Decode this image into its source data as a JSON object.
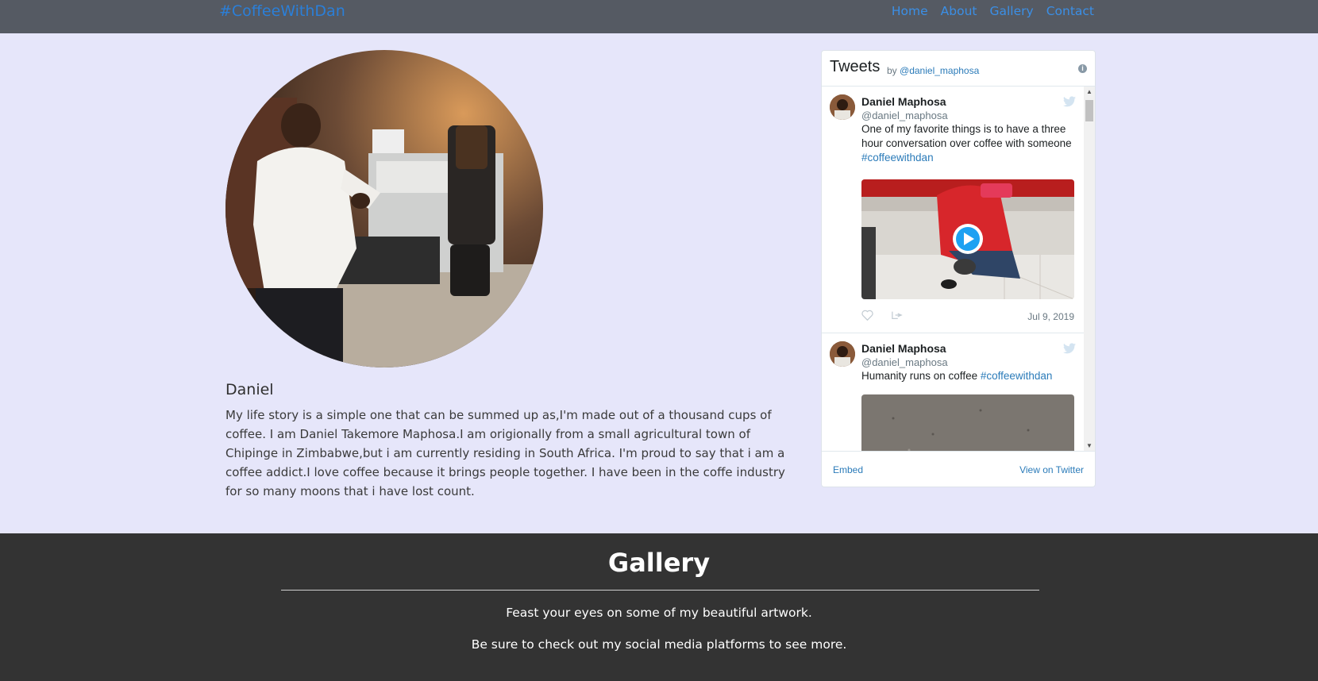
{
  "nav": {
    "brand": "#CoffeeWithDan",
    "links": [
      "Home",
      "About",
      "Gallery",
      "Contact"
    ]
  },
  "profile": {
    "name": "Daniel",
    "bio": "My life story is a simple one that can be summed up as,I'm made out of a thousand cups of coffee. I am Daniel Takemore Maphosa.I am origionally from a small agricultural town of Chipinge in Zimbabwe,but i am currently residing in South Africa. I'm proud to say that i am a coffee addict.I love coffee because it brings people together. I have been in the coffe industry for so many moons that i have lost count."
  },
  "timeline": {
    "title": "Tweets",
    "by": "by",
    "handle": "@daniel_maphosa",
    "tweets": [
      {
        "name": "Daniel Maphosa",
        "handle": "@daniel_maphosa",
        "text": "One of my favorite things is to have a three hour conversation over coffee with someone ",
        "tag": "#coffeewithdan",
        "date": "Jul 9, 2019"
      },
      {
        "name": "Daniel Maphosa",
        "handle": "@daniel_maphosa",
        "text": "Humanity runs on coffee ",
        "tag": "#coffeewithdan"
      }
    ],
    "embed": "Embed",
    "view_on_twitter": "View on Twitter"
  },
  "gallery": {
    "title": "Gallery",
    "line1": "Feast your eyes on some of my beautiful artwork.",
    "line2": "Be sure to check out my social media platforms to see more."
  },
  "colors": {
    "page_bg": "#e6e6fa",
    "navbar_bg": "#555a63",
    "link": "#3b8fe6",
    "gallery_bg": "#333333",
    "twitter_link": "#2b7bb9"
  }
}
